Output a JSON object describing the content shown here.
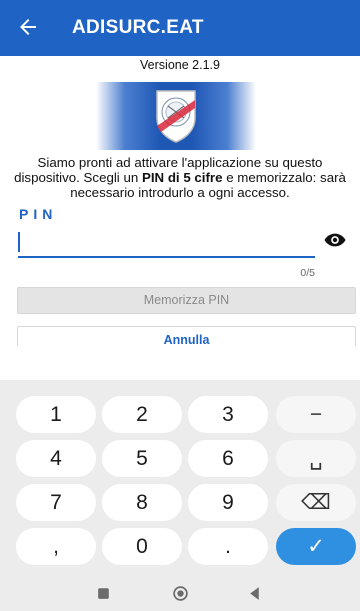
{
  "app_bar": {
    "title": "ADISURC.EAT",
    "back_icon": "arrow-left-icon",
    "color": "#1f63c4"
  },
  "version": "Versione 2.1.9",
  "logo": {
    "type": "shield-icon",
    "text": "ADISURC"
  },
  "intro": {
    "part1": "Siamo pronti ad attivare l'applicazione su questo dispositivo. Scegli un ",
    "bold1": "PIN di 5 cifre",
    "part2": " e memorizzalo: sarà necessario introdurlo a ogni accesso."
  },
  "pin": {
    "label": "PIN",
    "value": "",
    "counter": "0/5",
    "toggle_icon": "eye-icon"
  },
  "buttons": {
    "save": "Memorizza PIN",
    "cancel": "Annulla"
  },
  "keyboard": {
    "keys": [
      "1",
      "2",
      "3",
      "−",
      "4",
      "5",
      "6",
      "␣",
      "7",
      "8",
      "9",
      "⌫",
      ",",
      "0",
      ".",
      "✓"
    ]
  },
  "nav": {
    "icons": [
      "recents-icon",
      "home-icon",
      "back-triangle-icon"
    ]
  }
}
